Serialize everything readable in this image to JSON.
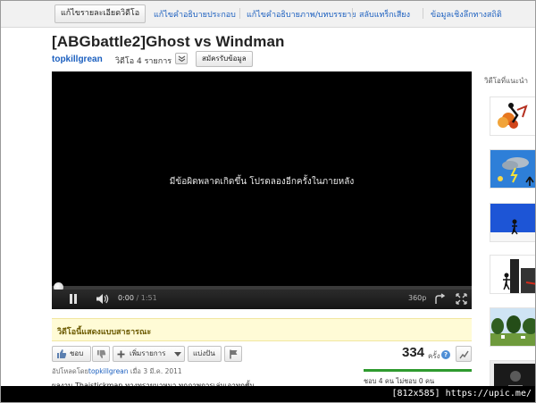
{
  "topbar": {
    "edit_video_details": "แก้ไขรายละเอียดวิดีโอ",
    "links": [
      "แก้ไขคำอธิบายประกอบ",
      "แก้ไขคำอธิบายภาพ/บทบรรยาย",
      "สลับแทร็กเสียง",
      "ข้อมูลเชิงลึกทางสถิติ"
    ]
  },
  "video": {
    "title": "[ABGbattle2]Ghost vs Windman",
    "channel": "topkillgrean",
    "video_count": "วิดีโอ 4 รายการ",
    "subscribe_label": "สมัครรับข้อมูล"
  },
  "player": {
    "error_message": "มีข้อผิดพลาดเกิดขึ้น โปรดลองอีกครั้งในภายหลัง",
    "current_time": "0:00",
    "duration": "/ 1:51",
    "quality": "360p",
    "progress": 0
  },
  "sidebar": {
    "recommended_label": "วิดีโอที่แนะนำ"
  },
  "visibility": {
    "public_text": "วิดีโอนี้แสดงแบบสาธารณะ"
  },
  "actions": {
    "like_label": "ชอบ",
    "add_to_label": "เพิ่มรายการ",
    "share_label": "แบ่งปัน",
    "view_count": "334",
    "view_unit": "ครั้ง",
    "help": "?"
  },
  "meta": {
    "uploaded_by_prefix": "อัปโหลดโดย",
    "uploader": "topkillgrean",
    "date": "เมื่อ 3 มี.ค. 2011",
    "description": "ผลงาน Thaistickman ทางทรายนาหมา ทุกภาพการเล่นเอาทุกชั้น",
    "likes_text": "ชอบ 4 คน ไม่ชอบ 0 คน"
  },
  "footer": {
    "text": "[812x585] https://upic.me/"
  },
  "colors": {
    "link": "#1b5fbf",
    "player_bg": "#000000",
    "public_bg": "#fffbd6",
    "like_bar": "#2f9b2f"
  }
}
